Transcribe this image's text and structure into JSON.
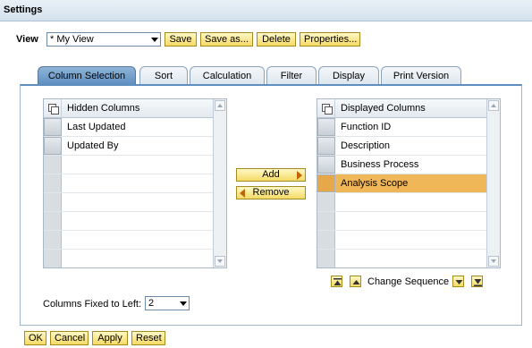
{
  "header": {
    "title": "Settings"
  },
  "view": {
    "label": "View",
    "selected": "* My View",
    "buttons": [
      "Save",
      "Save as...",
      "Delete",
      "Properties..."
    ]
  },
  "tabs": [
    {
      "label": "Column Selection",
      "active": true
    },
    {
      "label": "Sort",
      "active": false
    },
    {
      "label": "Calculation",
      "active": false
    },
    {
      "label": "Filter",
      "active": false
    },
    {
      "label": "Display",
      "active": false
    },
    {
      "label": "Print Version",
      "active": false
    }
  ],
  "hidden_columns": {
    "header": "Hidden Columns",
    "rows": [
      "Last Updated",
      "Updated By"
    ]
  },
  "displayed_columns": {
    "header": "Displayed Columns",
    "rows": [
      "Function ID",
      "Description",
      "Business Process",
      "Analysis Scope"
    ],
    "selected_index": 3
  },
  "move": {
    "add": "Add",
    "remove": "Remove"
  },
  "sequence": {
    "label": "Change Sequence"
  },
  "fixed": {
    "label": "Columns Fixed to Left:",
    "value": "2"
  },
  "footer": {
    "ok": "OK",
    "cancel": "Cancel",
    "apply": "Apply",
    "reset": "Reset"
  },
  "colors": {
    "accent": "#5d8ebf",
    "button": "#f5da64",
    "selection": "#f0b758"
  }
}
